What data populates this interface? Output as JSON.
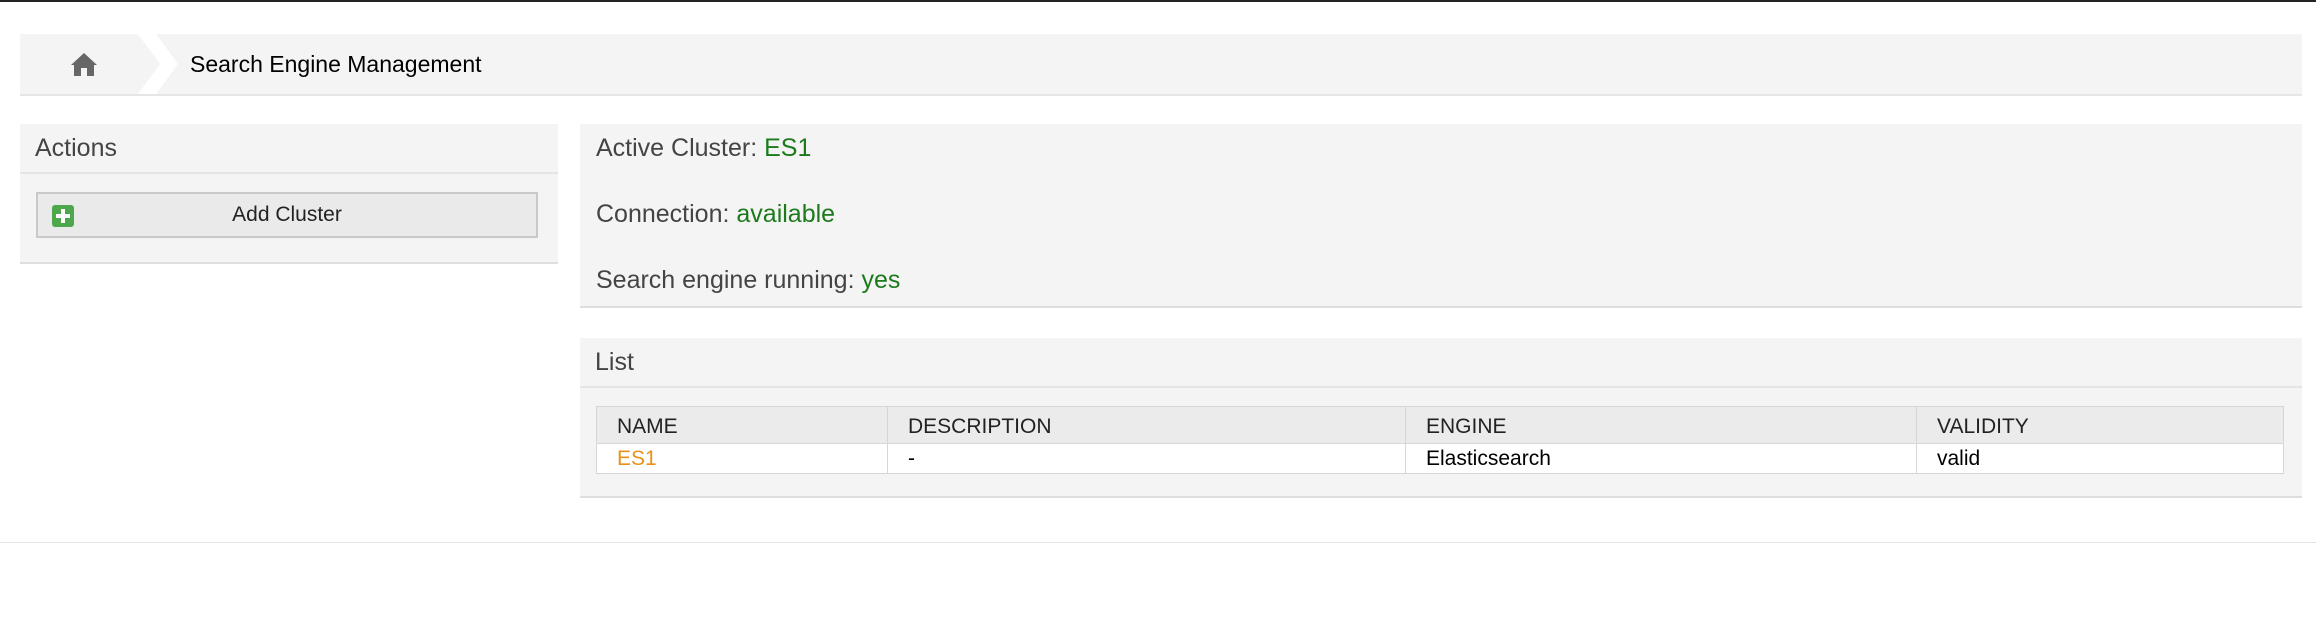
{
  "breadcrumb": {
    "home_icon": "home-icon",
    "title": "Search Engine Management"
  },
  "actions": {
    "header": "Actions",
    "add_cluster_label": "Add Cluster",
    "add_icon": "plus-square-icon"
  },
  "status": {
    "active_cluster_label": "Active Cluster:",
    "active_cluster_value": "ES1",
    "connection_label": "Connection:",
    "connection_value": "available",
    "running_label": "Search engine running:",
    "running_value": "yes"
  },
  "list": {
    "header": "List",
    "columns": [
      "NAME",
      "DESCRIPTION",
      "ENGINE",
      "VALIDITY"
    ],
    "rows": [
      {
        "name": "ES1",
        "description": "-",
        "engine": "Elasticsearch",
        "validity": "valid"
      }
    ]
  },
  "colors": {
    "accent_link": "#e8921a",
    "status_green": "#1c7a1c",
    "panel_bg": "#f4f4f4"
  }
}
